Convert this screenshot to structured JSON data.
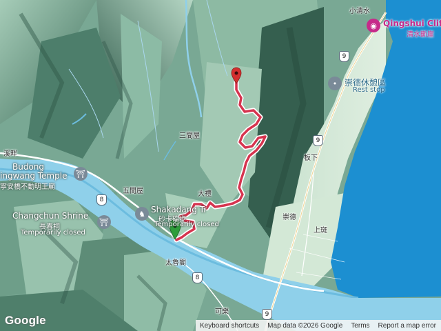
{
  "map": {
    "place_labels": [
      {
        "id": "xiaoqingshui",
        "text": "小清水"
      },
      {
        "id": "banxia",
        "text": "板下"
      },
      {
        "id": "sanjianwu",
        "text": "三間屋"
      },
      {
        "id": "wujianwu",
        "text": "五間屋"
      },
      {
        "id": "dali",
        "text": "大禮"
      },
      {
        "id": "chongde",
        "text": "崇德"
      },
      {
        "id": "shangban",
        "text": "上斑"
      },
      {
        "id": "taluge",
        "text": "太魯閣"
      },
      {
        "id": "kele",
        "text": "可樂"
      },
      {
        "id": "xipan",
        "text": "溪畔"
      }
    ],
    "pois": {
      "qingshui": {
        "title": "Qingshui Cliff",
        "subtitle": "清水斷崖"
      },
      "chongde_rest": {
        "title": "崇德休憩區",
        "subtitle": "Rest stop"
      },
      "budong": {
        "title": "Budong",
        "title2": "ingwang Temple",
        "subtitle": "寧安橋不動明王廟"
      },
      "changchun": {
        "title": "Changchun Shrine",
        "subtitle": "長春祠",
        "status": "Temporarily closed"
      },
      "shakadang": {
        "title": "Shakadang Tr",
        "subtitle": "砂卡礑步",
        "status": "Temporarily closed",
        "status_visible": "Temp"
      }
    },
    "route_shields": [
      "8",
      "8",
      "9",
      "9",
      "8",
      "9"
    ],
    "colors": {
      "route": "#d6344f",
      "route_edge": "#ffffff",
      "sea": "#1c8fd1",
      "river": "#8fd0ea",
      "highway": "#ffffff",
      "marker_end": "#d32f2f",
      "marker_start": "#2e9d3a"
    },
    "markers": {
      "start": "start-marker",
      "end": "end-marker"
    }
  },
  "attribution": {
    "logo": "Google",
    "shortcuts": "Keyboard shortcuts",
    "data": "Map data ©2026 Google",
    "terms": "Terms",
    "report": "Report a map error"
  }
}
